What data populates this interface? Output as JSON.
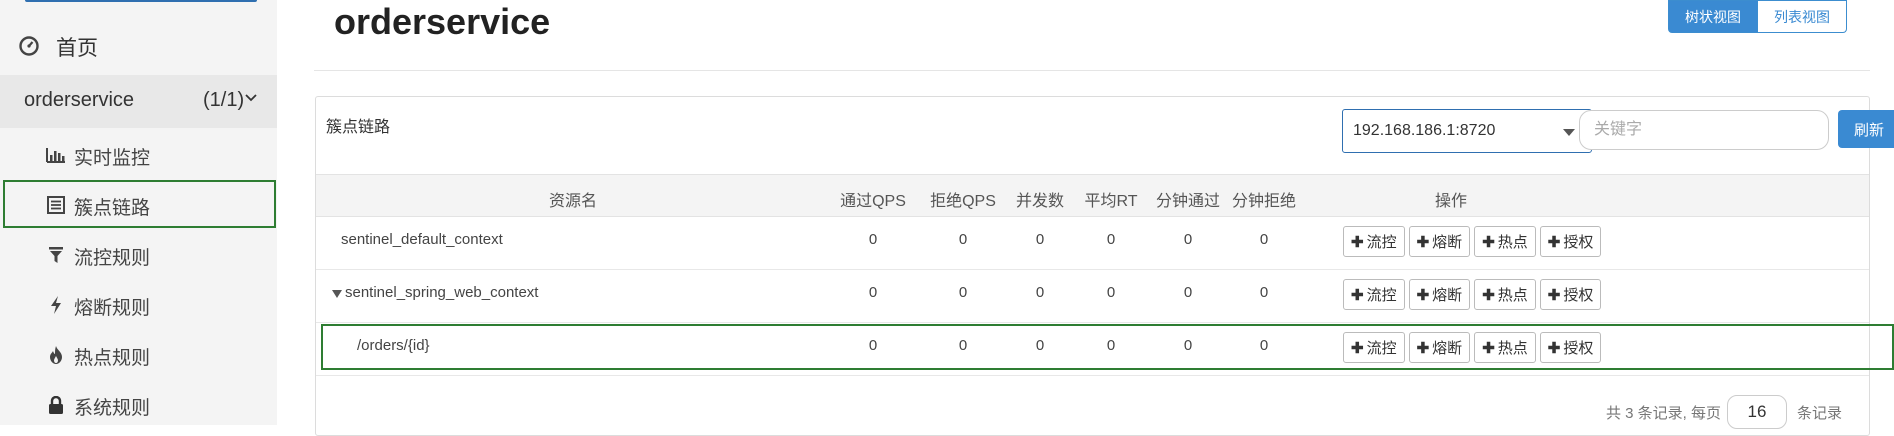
{
  "sidebar": {
    "home_label": "首页",
    "app": {
      "name": "orderservice",
      "count": "(1/1)"
    },
    "items": [
      {
        "label": "实时监控",
        "icon": "bar-chart-icon"
      },
      {
        "label": "簇点链路",
        "icon": "list-icon"
      },
      {
        "label": "流控规则",
        "icon": "filter-icon"
      },
      {
        "label": "熔断规则",
        "icon": "bolt-icon"
      },
      {
        "label": "热点规则",
        "icon": "fire-icon"
      },
      {
        "label": "系统规则",
        "icon": "lock-icon"
      }
    ]
  },
  "header": {
    "title": "orderservice",
    "view_tree": "树状视图",
    "view_list": "列表视图"
  },
  "panel": {
    "title": "簇点链路",
    "machine": "192.168.186.1:8720",
    "keyword_placeholder": "关键字",
    "refresh_label": "刷新"
  },
  "table": {
    "columns": [
      "资源名",
      "通过QPS",
      "拒绝QPS",
      "并发数",
      "平均RT",
      "分钟通过",
      "分钟拒绝",
      "操作"
    ],
    "rows": [
      {
        "resource": "sentinel_default_context",
        "pass_qps": "0",
        "block_qps": "0",
        "threads": "0",
        "avg_rt": "0",
        "min_pass": "0",
        "min_block": "0"
      },
      {
        "resource": "sentinel_spring_web_context",
        "pass_qps": "0",
        "block_qps": "0",
        "threads": "0",
        "avg_rt": "0",
        "min_pass": "0",
        "min_block": "0"
      },
      {
        "resource": "/orders/{id}",
        "pass_qps": "0",
        "block_qps": "0",
        "threads": "0",
        "avg_rt": "0",
        "min_pass": "0",
        "min_block": "0"
      }
    ],
    "actions": [
      "流控",
      "熔断",
      "热点",
      "授权"
    ]
  },
  "pagination": {
    "total_prefix": "共 3 条记录, 每页",
    "page_size": "16",
    "suffix": "条记录"
  },
  "colors": {
    "accent": "#3a8ad2",
    "highlight": "#2e7d32"
  }
}
